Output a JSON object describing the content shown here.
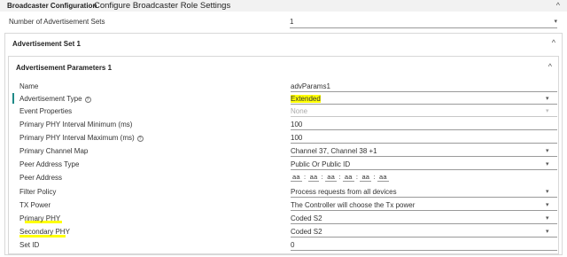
{
  "header": {
    "section": "Broadcaster Configuration",
    "title": "Configure Broadcaster Role Settings"
  },
  "num_sets": {
    "label": "Number of Advertisement Sets",
    "value": "1"
  },
  "adv_set": {
    "title": "Advertisement Set 1"
  },
  "adv_params": {
    "title": "Advertisement Parameters 1",
    "fields": [
      {
        "label": "Name",
        "value": "advParams1"
      },
      {
        "label": "Advertisement Type",
        "value": "Extended"
      },
      {
        "label": "Event Properties",
        "value": "None"
      },
      {
        "label": "Primary PHY Interval Minimum (ms)",
        "value": "100"
      },
      {
        "label": "Primary PHY Interval Maximum (ms)",
        "value": "100"
      },
      {
        "label": "Primary Channel Map",
        "value": "Channel 37, Channel 38 +1"
      },
      {
        "label": "Peer Address Type",
        "value": "Public Or Public ID"
      },
      {
        "label": "Peer Address",
        "value": ""
      },
      {
        "label": "Filter Policy",
        "value": "Process requests from all devices"
      },
      {
        "label": "TX Power",
        "value": "The Controller will choose the Tx power"
      },
      {
        "label": "Primary PHY",
        "value": "Coded S2"
      },
      {
        "label": "Secondary PHY",
        "value": "Coded S2"
      },
      {
        "label": "Set ID",
        "value": "0"
      }
    ],
    "peer_address_octets": [
      "aa",
      "aa",
      "aa",
      "aa",
      "aa",
      "aa"
    ],
    "help_glyph": "?"
  },
  "icons": {
    "collapse": "^",
    "dropdown": "▾"
  },
  "colors": {
    "highlight": "#ffff00",
    "active_bar": "#1f8a88"
  }
}
